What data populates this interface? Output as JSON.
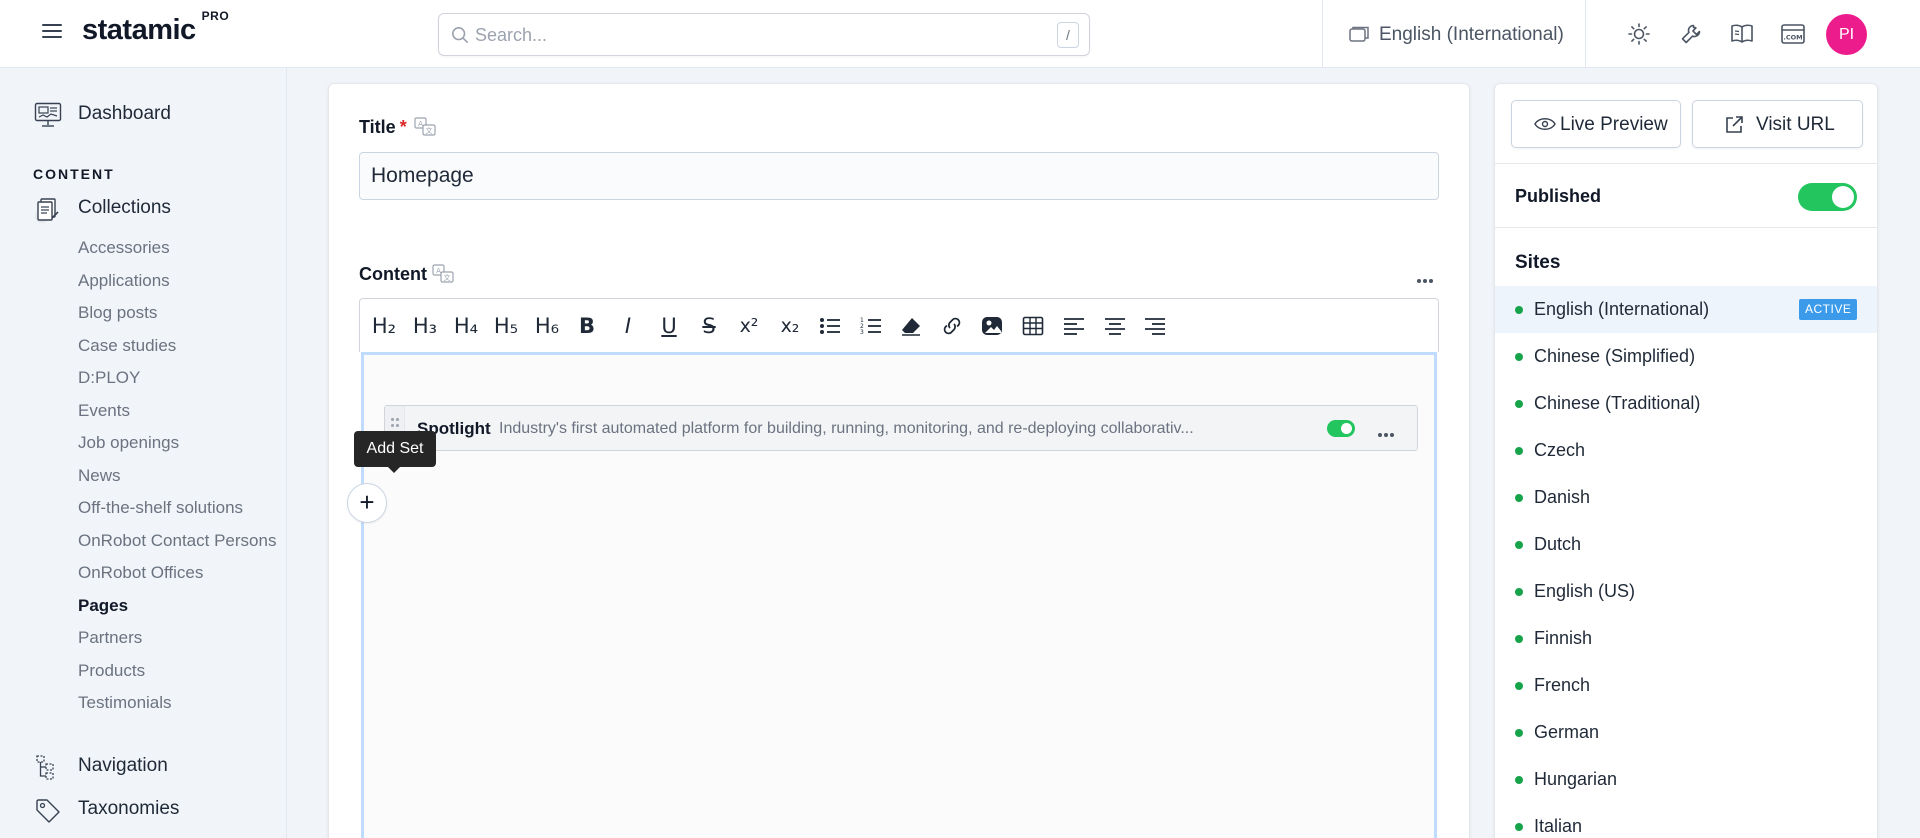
{
  "header": {
    "app_name": "statamic",
    "edition": "PRO",
    "search_placeholder": "Search...",
    "search_shortcut": "/",
    "site_selector": "English (International)",
    "avatar_initials": "PI"
  },
  "sidebar": {
    "dashboard": "Dashboard",
    "section_label": "CONTENT",
    "collections": "Collections",
    "collection_items": [
      "Accessories",
      "Applications",
      "Blog posts",
      "Case studies",
      "D:PLOY",
      "Events",
      "Job openings",
      "News",
      "Off-the-shelf solutions",
      "OnRobot Contact Persons",
      "OnRobot Offices",
      "Pages",
      "Partners",
      "Products",
      "Testimonials"
    ],
    "active_collection": "Pages",
    "navigation": "Navigation",
    "taxonomies": "Taxonomies"
  },
  "main": {
    "title_label": "Title",
    "required_mark": "*",
    "title_value": "Homepage",
    "content_label": "Content",
    "toolbar_buttons": [
      "H₂",
      "H₃",
      "H₄",
      "H₅",
      "H₆",
      "B",
      "I",
      "U",
      "S",
      "x²",
      "x₂",
      "bullet-list",
      "ordered-list",
      "eraser",
      "link",
      "image",
      "table",
      "align-left",
      "align-center",
      "align-right"
    ],
    "set": {
      "name": "Spotlight",
      "preview": "Industry's first automated platform for building, running, monitoring, and re-deploying collaborativ..."
    },
    "tooltip": "Add Set",
    "add_button": "+"
  },
  "panel": {
    "live_preview": "Live Preview",
    "visit_url": "Visit URL",
    "published_label": "Published",
    "sites_label": "Sites",
    "active_badge": "ACTIVE",
    "sites": [
      "English (International)",
      "Chinese (Simplified)",
      "Chinese (Traditional)",
      "Czech",
      "Danish",
      "Dutch",
      "English (US)",
      "Finnish",
      "French",
      "German",
      "Hungarian",
      "Italian"
    ]
  },
  "colors": {
    "accent_green": "#22c55e",
    "active_badge": "#3b9bea",
    "avatar": "#ec1c8d",
    "editor_focus": "#bfdbfe"
  }
}
